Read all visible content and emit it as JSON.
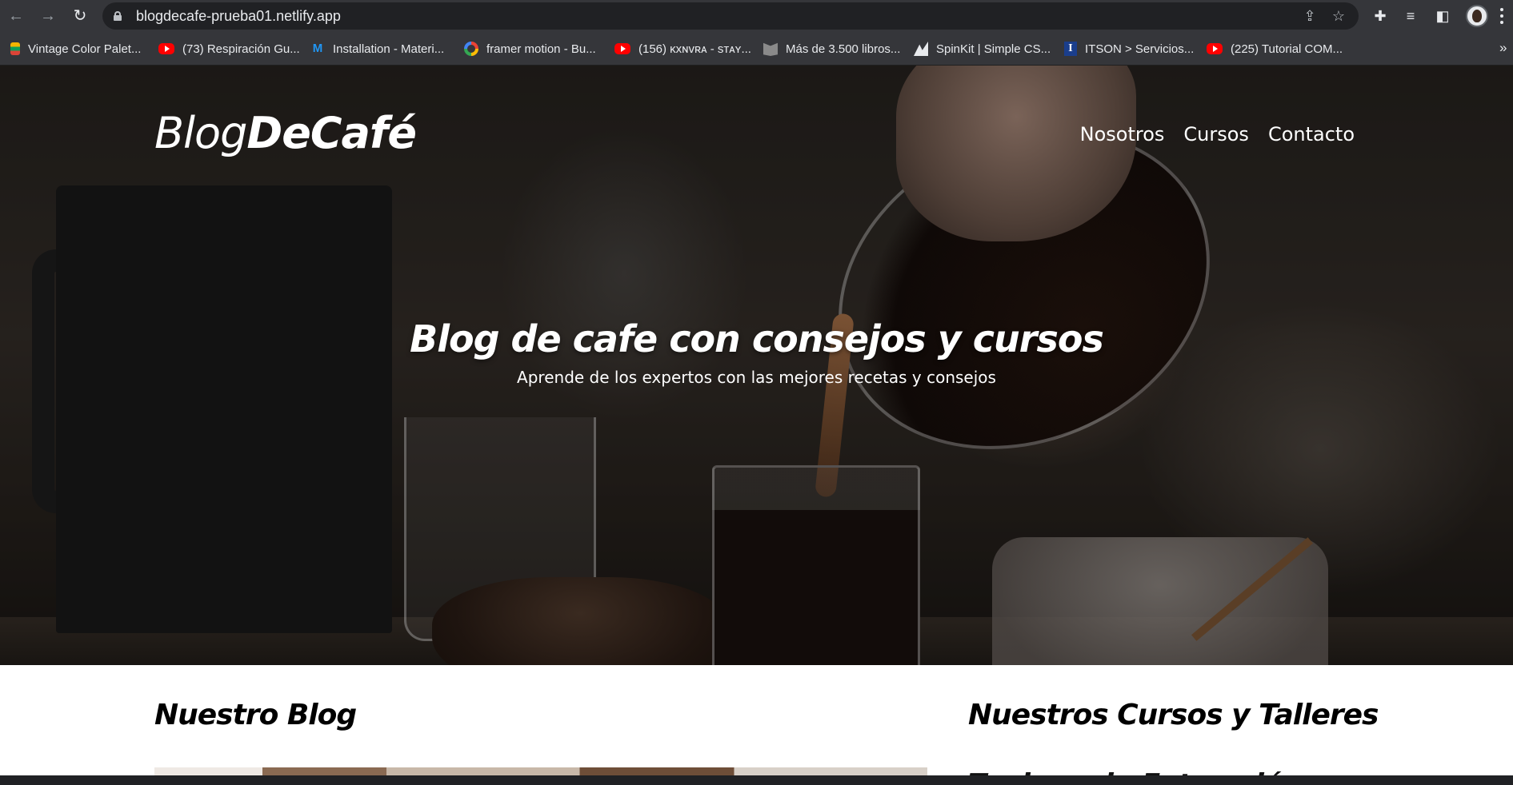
{
  "browser": {
    "url": "blogdecafe-prueba01.netlify.app",
    "icons": {
      "back": "arrow-left-icon",
      "forward": "arrow-right-icon",
      "reload": "reload-icon",
      "lock": "lock-icon",
      "share": "share-icon",
      "bookmark": "star-icon",
      "extensions": "puzzle-icon",
      "reading_list": "playlist-icon",
      "side_panel": "side-panel-icon",
      "menu": "kebab-menu-icon"
    },
    "bookmarks": [
      {
        "label": "Vintage Color Palet...",
        "icon": "palette-favicon"
      },
      {
        "label": "(73) Respiración Gu...",
        "icon": "youtube-favicon"
      },
      {
        "label": "Installation - Materi...",
        "icon": "mui-favicon"
      },
      {
        "label": "framer motion - Bu...",
        "icon": "google-favicon"
      },
      {
        "label": "(156) ĸxɴvʀᴀ - sᴛᴀʏ...",
        "icon": "youtube-favicon"
      },
      {
        "label": "Más de 3.500 libros...",
        "icon": "book-favicon"
      },
      {
        "label": "SpinKit | Simple CS...",
        "icon": "spinkit-favicon"
      },
      {
        "label": "ITSON > Servicios...",
        "icon": "itson-favicon"
      },
      {
        "label": "(225) Tutorial COM...",
        "icon": "youtube-favicon"
      }
    ],
    "bookmarks_overflow": "»"
  },
  "site": {
    "logo_light": "Blog",
    "logo_bold": "DeCafé",
    "nav": [
      "Nosotros",
      "Cursos",
      "Contacto"
    ],
    "hero_title": "Blog de cafe con consejos y cursos",
    "hero_subtitle": "Aprende de los expertos con las mejores recetas y consejos",
    "blog_heading": "Nuestro Blog",
    "courses_heading": "Nuestros Cursos y Talleres",
    "course_preview": "Taninos de Extracción de Café"
  },
  "colors": {
    "chrome_bg": "#35363a",
    "omnibox_bg": "#202124",
    "chrome_text": "#e8eaed",
    "page_bg": "#ffffff",
    "hero_text": "#ffffff",
    "heading_text": "#000000"
  }
}
